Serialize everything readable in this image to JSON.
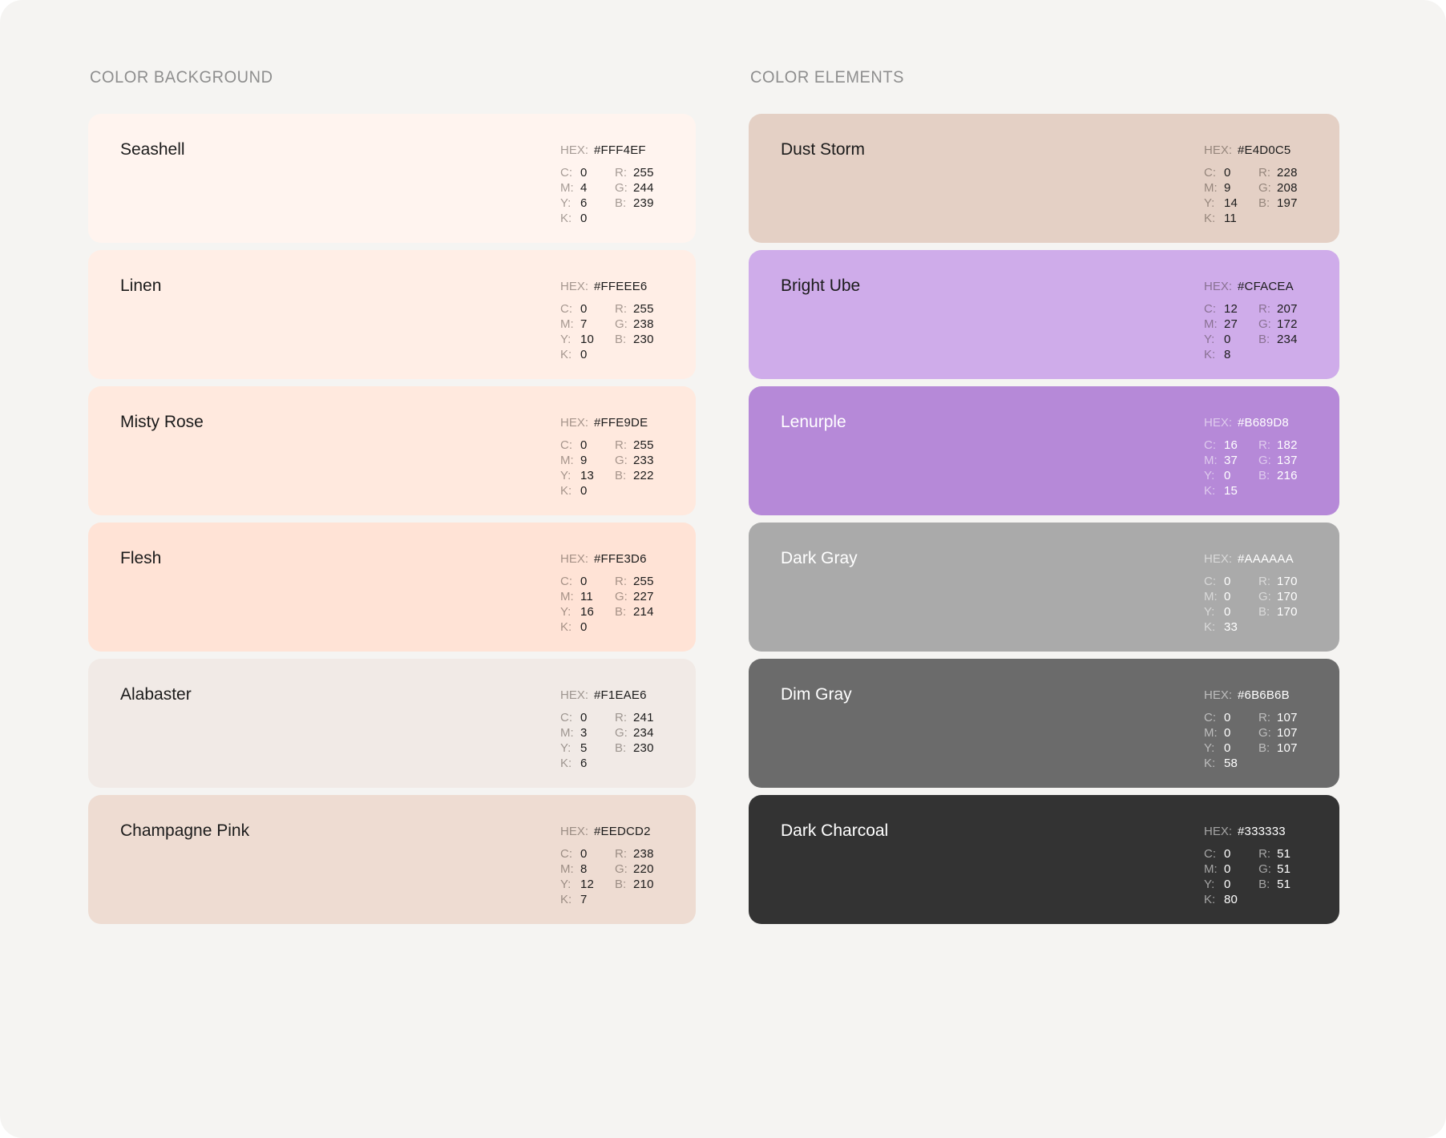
{
  "page": {
    "background": "#F5F4F2"
  },
  "labels": {
    "hex": "HEX:",
    "c": "C:",
    "m": "M:",
    "y": "Y:",
    "k": "K:",
    "r": "R:",
    "g": "G:",
    "b": "B:"
  },
  "sections": [
    {
      "title": "COLOR BACKGROUND",
      "cards": [
        {
          "name": "Seashell",
          "hex": "#FFF4EF",
          "cmyk": {
            "c": "0",
            "m": "4",
            "y": "6",
            "k": "0"
          },
          "rgb": {
            "r": "255",
            "g": "244",
            "b": "239"
          },
          "text_theme": "dark"
        },
        {
          "name": "Linen",
          "hex": "#FFEEE6",
          "cmyk": {
            "c": "0",
            "m": "7",
            "y": "10",
            "k": "0"
          },
          "rgb": {
            "r": "255",
            "g": "238",
            "b": "230"
          },
          "text_theme": "dark"
        },
        {
          "name": "Misty Rose",
          "hex": "#FFE9DE",
          "cmyk": {
            "c": "0",
            "m": "9",
            "y": "13",
            "k": "0"
          },
          "rgb": {
            "r": "255",
            "g": "233",
            "b": "222"
          },
          "text_theme": "dark"
        },
        {
          "name": "Flesh",
          "hex": "#FFE3D6",
          "cmyk": {
            "c": "0",
            "m": "11",
            "y": "16",
            "k": "0"
          },
          "rgb": {
            "r": "255",
            "g": "227",
            "b": "214"
          },
          "text_theme": "dark"
        },
        {
          "name": "Alabaster",
          "hex": "#F1EAE6",
          "cmyk": {
            "c": "0",
            "m": "3",
            "y": "5",
            "k": "6"
          },
          "rgb": {
            "r": "241",
            "g": "234",
            "b": "230"
          },
          "text_theme": "dark"
        },
        {
          "name": "Champagne Pink",
          "hex": "#EEDCD2",
          "cmyk": {
            "c": "0",
            "m": "8",
            "y": "12",
            "k": "7"
          },
          "rgb": {
            "r": "238",
            "g": "220",
            "b": "210"
          },
          "text_theme": "dark"
        }
      ]
    },
    {
      "title": "COLOR ELEMENTS",
      "cards": [
        {
          "name": "Dust Storm",
          "hex": "#E4D0C5",
          "cmyk": {
            "c": "0",
            "m": "9",
            "y": "14",
            "k": "11"
          },
          "rgb": {
            "r": "228",
            "g": "208",
            "b": "197"
          },
          "text_theme": "dark"
        },
        {
          "name": "Bright Ube",
          "hex": "#CFACEA",
          "cmyk": {
            "c": "12",
            "m": "27",
            "y": "0",
            "k": "8"
          },
          "rgb": {
            "r": "207",
            "g": "172",
            "b": "234"
          },
          "text_theme": "dark"
        },
        {
          "name": "Lenurple",
          "hex": "#B689D8",
          "cmyk": {
            "c": "16",
            "m": "37",
            "y": "0",
            "k": "15"
          },
          "rgb": {
            "r": "182",
            "g": "137",
            "b": "216"
          },
          "text_theme": "light"
        },
        {
          "name": "Dark Gray",
          "hex": "#AAAAAA",
          "cmyk": {
            "c": "0",
            "m": "0",
            "y": "0",
            "k": "33"
          },
          "rgb": {
            "r": "170",
            "g": "170",
            "b": "170"
          },
          "text_theme": "light"
        },
        {
          "name": "Dim Gray",
          "hex": "#6B6B6B",
          "cmyk": {
            "c": "0",
            "m": "0",
            "y": "0",
            "k": "58"
          },
          "rgb": {
            "r": "107",
            "g": "107",
            "b": "107"
          },
          "text_theme": "light"
        },
        {
          "name": "Dark Charcoal",
          "hex": "#333333",
          "cmyk": {
            "c": "0",
            "m": "0",
            "y": "0",
            "k": "80"
          },
          "rgb": {
            "r": "51",
            "g": "51",
            "b": "51"
          },
          "text_theme": "light"
        }
      ]
    }
  ]
}
